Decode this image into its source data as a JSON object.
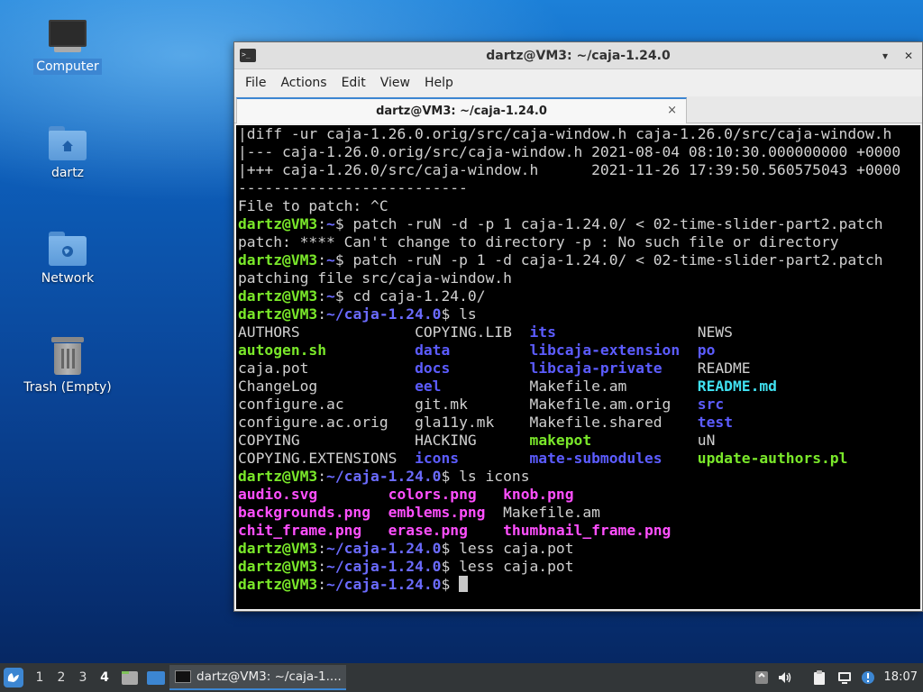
{
  "desktop": {
    "icons": [
      {
        "label": "Computer"
      },
      {
        "label": "dartz"
      },
      {
        "label": "Network"
      },
      {
        "label": "Trash (Empty)"
      }
    ]
  },
  "window": {
    "title": "dartz@VM3: ~/caja-1.24.0",
    "menu": [
      "File",
      "Actions",
      "Edit",
      "View",
      "Help"
    ],
    "tab_label": "dartz@VM3: ~/caja-1.24.0",
    "tab_close": "×",
    "min_glyph": "▾",
    "close_glyph": "✕"
  },
  "terminal": {
    "prompt_user": "dartz@VM3",
    "lines": [
      "|diff -ur caja-1.26.0.orig/src/caja-window.h caja-1.26.0/src/caja-window.h",
      "|--- caja-1.26.0.orig/src/caja-window.h 2021-08-04 08:10:30.000000000 +0000",
      "|+++ caja-1.26.0/src/caja-window.h      2021-11-26 17:39:50.560575043 +0000",
      "--------------------------",
      "File to patch: ^C",
      "$ patch -ruN -d -p 1 caja-1.24.0/ < 02-time-slider-part2.patch",
      "patch: **** Can't change to directory -p : No such file or directory",
      "$ patch -ruN -p 1 -d caja-1.24.0/ < 02-time-slider-part2.patch",
      "patching file src/caja-window.h",
      "$ cd caja-1.24.0/",
      "$ ls",
      "$ ls icons",
      "$ less caja.pot",
      "$ less caja.pot",
      "$ "
    ],
    "path_home": "~",
    "path_caja": "~/caja-1.24.0",
    "ls_rows": [
      [
        "AUTHORS",
        "COPYING.LIB",
        "its",
        "NEWS"
      ],
      [
        "autogen.sh",
        "data",
        "libcaja-extension",
        "po"
      ],
      [
        "caja.pot",
        "docs",
        "libcaja-private",
        "README"
      ],
      [
        "ChangeLog",
        "eel",
        "Makefile.am",
        "README.md"
      ],
      [
        "configure.ac",
        "git.mk",
        "Makefile.am.orig",
        "src"
      ],
      [
        "configure.ac.orig",
        "gla11y.mk",
        "Makefile.shared",
        "test"
      ],
      [
        "COPYING",
        "HACKING",
        "makepot",
        "uN"
      ],
      [
        "COPYING.EXTENSIONS",
        "icons",
        "mate-submodules",
        "update-authors.pl"
      ]
    ],
    "icons_rows": [
      [
        "audio.svg",
        "colors.png",
        "knob.png"
      ],
      [
        "backgrounds.png",
        "emblems.png",
        "Makefile.am"
      ],
      [
        "chit_frame.png",
        "erase.png",
        "thumbnail_frame.png"
      ]
    ]
  },
  "taskbar": {
    "workspaces": [
      "1",
      "2",
      "3",
      "4"
    ],
    "active_workspace": "4",
    "task_label": "dartz@VM3: ~/caja-1....",
    "clock": "18:07"
  }
}
